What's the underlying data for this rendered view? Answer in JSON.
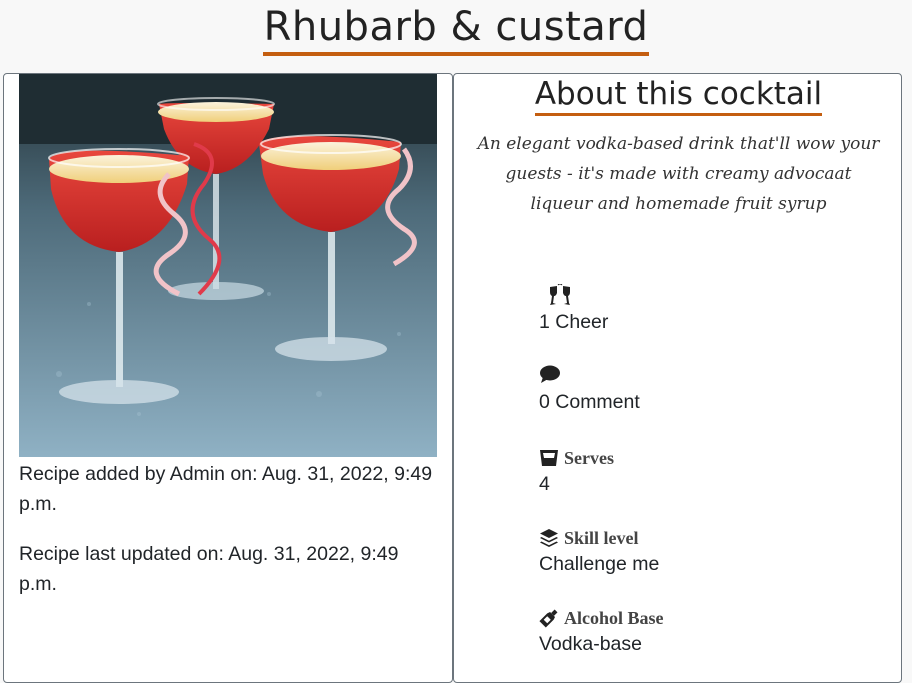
{
  "title": "Rhubarb & custard",
  "recipe": {
    "added": "Recipe added by Admin on: Aug. 31, 2022, 9:49 p.m.",
    "updated": "Recipe last updated on: Aug. 31, 2022, 9:49 p.m."
  },
  "about": {
    "heading": "About this cocktail",
    "description": "An elegant vodka-based drink that'll wow your guests - it's made with creamy advocaat liqueur and homemade fruit syrup"
  },
  "stats": {
    "cheers": {
      "icon": "glasses-cheers-icon",
      "value": "1 Cheer"
    },
    "comments": {
      "icon": "comment-icon",
      "value": "0 Comment"
    },
    "serves": {
      "icon": "glass-icon",
      "label": "Serves",
      "value": "4"
    },
    "skill": {
      "icon": "layers-icon",
      "label": "Skill level",
      "value": "Challenge me"
    },
    "alcohol": {
      "icon": "bottle-icon",
      "label": "Alcohol Base",
      "value": "Vodka-base"
    }
  },
  "colors": {
    "accent_underline": "#c45e10",
    "card_border": "#6c757d",
    "cocktail_red": "#d9352f"
  }
}
